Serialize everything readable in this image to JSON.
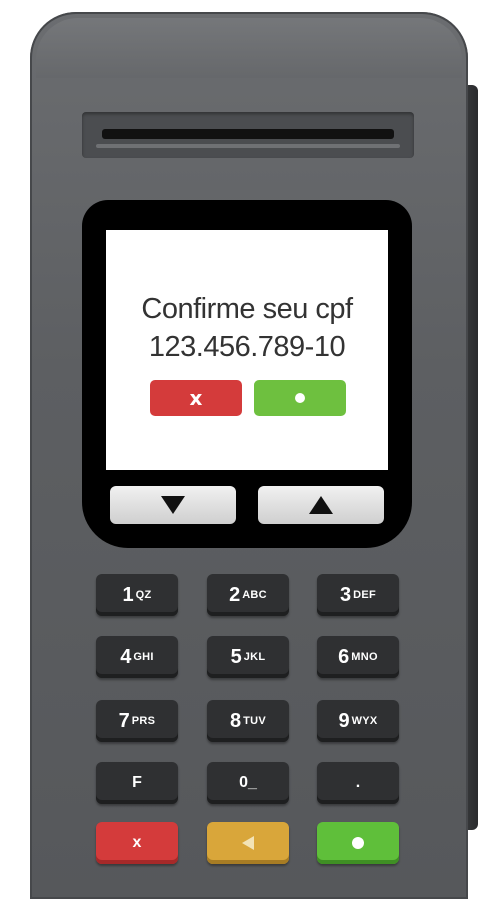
{
  "display": {
    "prompt": "Confirme seu cpf",
    "cpf": "123.456.789-10",
    "cancel_symbol": "x",
    "confirm_symbol": "dot-icon"
  },
  "keypad": {
    "keys": [
      {
        "num": "1",
        "letters": "QZ"
      },
      {
        "num": "2",
        "letters": "ABC"
      },
      {
        "num": "3",
        "letters": "DEF"
      },
      {
        "num": "4",
        "letters": "GHI"
      },
      {
        "num": "5",
        "letters": "JKL"
      },
      {
        "num": "6",
        "letters": "MNO"
      },
      {
        "num": "7",
        "letters": "PRS"
      },
      {
        "num": "8",
        "letters": "TUV"
      },
      {
        "num": "9",
        "letters": "WYX"
      },
      {
        "num": "F",
        "letters": ""
      },
      {
        "num": "0_",
        "letters": ""
      },
      {
        "num": ".",
        "letters": ""
      }
    ],
    "cancel_label": "x"
  },
  "colors": {
    "cancel": "#d43b3b",
    "confirm": "#6ec03f",
    "backspace": "#d9a63a",
    "body": "#5d5f62"
  },
  "icons": {
    "scroll_down": "triangle-down-icon",
    "scroll_up": "triangle-up-icon",
    "backspace": "triangle-left-icon",
    "enter": "dot-icon"
  }
}
